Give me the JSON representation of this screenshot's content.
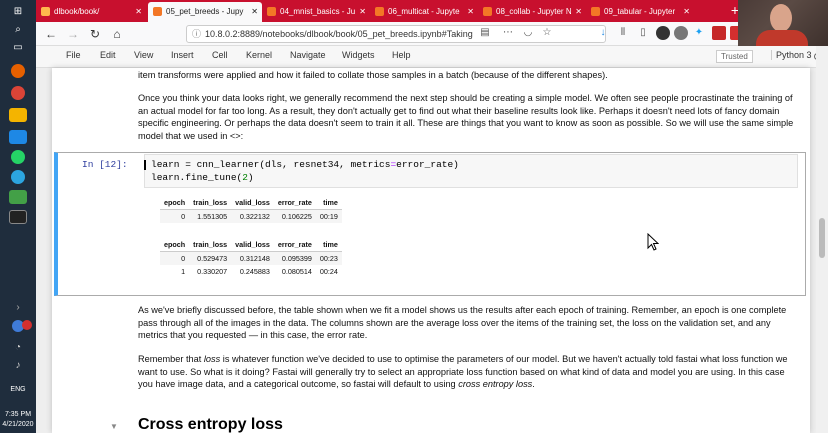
{
  "taskbar": {
    "clock_time": "7:35 PM",
    "clock_date": "4/21/2020",
    "lang": "ENG"
  },
  "tabs": [
    {
      "label": "dlbook/book/",
      "active": false
    },
    {
      "label": "05_pet_breeds - Jupy",
      "active": true
    },
    {
      "label": "04_mnist_basics - Ju",
      "active": false
    },
    {
      "label": "06_multicat - Jupyte",
      "active": false
    },
    {
      "label": "08_collab - Jupyter N",
      "active": false
    },
    {
      "label": "09_tabular - Jupyter",
      "active": false
    }
  ],
  "nav": {
    "url": "10.8.0.2:8889/notebooks/dlbook/book/05_pet_breeds.ipynb#Taking"
  },
  "jupyter_menu": {
    "items": [
      "File",
      "Edit",
      "View",
      "Insert",
      "Cell",
      "Kernel",
      "Navigate",
      "Widgets",
      "Help"
    ],
    "trusted": "Trusted",
    "kernel": "Python 3"
  },
  "notebook": {
    "para0": "item transforms were applied and how it failed to collate those samples in a batch (because of the different shapes).",
    "para1": "Once you think your data looks right, we generally recommend the next step should be creating a simple model. We often see people procrastinate the training of an actual model for far too long. As a result, they don't actually get to find out what their baseline results look like. Perhaps it doesn't need lots of fancy domain specific engineering. Or perhaps the data doesn't seem to train it all. These are things that you want to know as soon as possible. So we will use the same simple model that we used in <>:",
    "prompt": "In [12]:",
    "code_line1_a": "learn = cnn_learner(dls, resnet34, metrics",
    "code_line1_op": "=",
    "code_line1_b": "error_rate)",
    "code_line2_a": "learn.fine_tune(",
    "code_line2_num": "2",
    "code_line2_b": ")",
    "table1": {
      "headers": [
        "epoch",
        "train_loss",
        "valid_loss",
        "error_rate",
        "time"
      ],
      "rows": [
        [
          "0",
          "1.551305",
          "0.322132",
          "0.106225",
          "00:19"
        ]
      ]
    },
    "table2": {
      "headers": [
        "epoch",
        "train_loss",
        "valid_loss",
        "error_rate",
        "time"
      ],
      "rows": [
        [
          "0",
          "0.529473",
          "0.312148",
          "0.095399",
          "00:23"
        ],
        [
          "1",
          "0.330207",
          "0.245883",
          "0.080514",
          "00:24"
        ]
      ]
    },
    "para2": "As we've briefly discussed before, the table shown when we fit a model shows us the results after each epoch of training. Remember, an epoch is one complete pass through all of the images in the data. The columns shown are the average loss over the items of the training set, the loss on the validation set, and any metrics that you requested — in this case, the error rate.",
    "para3_a": "Remember that ",
    "para3_em1": "loss",
    "para3_b": " is whatever function we've decided to use to optimise the parameters of our model. But we haven't actually told fastai what loss function we want to use. So what is it doing? Fastai will generally try to select an appropriate loss function based on what kind of data and model you are using. In this case you have image data, and a categorical outcome, so fastai will default to using ",
    "para3_em2": "cross entropy loss",
    "para3_c": ".",
    "heading": "Cross entropy loss"
  }
}
